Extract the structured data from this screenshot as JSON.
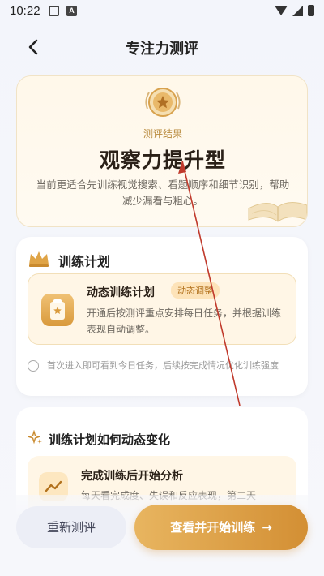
{
  "status_bar": {
    "time": "10:22",
    "badge_letter": "A"
  },
  "header": {
    "title": "专注力测评"
  },
  "result": {
    "label": "测评结果",
    "title": "观察力提升型",
    "description": "当前更适合先训练视觉搜索、看题顺序和细节识别，帮助减少漏看与粗心。"
  },
  "plan": {
    "title": "训练计划",
    "card_title": "动态训练计划",
    "badge": "动态调整",
    "card_desc": "开通后按测评重点安排每日任务，并根据训练表现自动调整。",
    "note": "首次进入即可看到今日任务，后续按完成情况优化训练强度"
  },
  "change": {
    "title": "训练计划如何动态变化",
    "step_title": "完成训练后开始分析",
    "step_desc": "每天看完成度、失误和反应表现，第二天"
  },
  "buttons": {
    "retest": "重新测评",
    "start": "查看并开始训练",
    "start_arrow": "→"
  },
  "colors": {
    "accent": "#d38f34",
    "annotation_arrow": "#c0392b"
  },
  "icons": [
    "back-arrow-icon",
    "medal-icon",
    "book-icon",
    "crown-icon",
    "clipboard-icon",
    "check-circle-icon",
    "sparkle-icon",
    "trend-icon",
    "arrow-right-icon"
  ]
}
